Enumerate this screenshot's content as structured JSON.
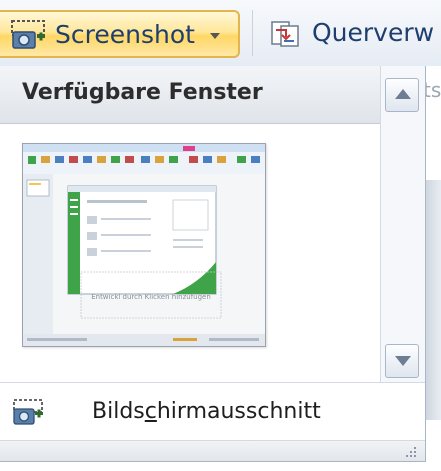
{
  "ribbon": {
    "screenshot_label": "Screenshot",
    "crossref_label": "Querverw"
  },
  "dropdown": {
    "gallery_title": "Verfügbare Fenster",
    "thumbnail_caption": "Entwickl durch Klicken hinzufügen",
    "bleed_text": "ts",
    "menu_item_label_pre": "Bilds",
    "menu_item_label_accel": "c",
    "menu_item_label_post": "hirmausschnitt"
  },
  "colors": {
    "accent_border": "#e3b54c",
    "accent_fill": "#ffd766",
    "ribbon_text": "#1e3f6e",
    "office_green": "#3fa34a"
  },
  "icons": {
    "screenshot": "camera-screenshot-icon",
    "crossref": "cross-reference-icon",
    "scroll_up": "triangle-up-icon",
    "scroll_down": "triangle-down-icon",
    "clip": "screen-clipping-icon",
    "grip": "resize-grip-icon"
  }
}
